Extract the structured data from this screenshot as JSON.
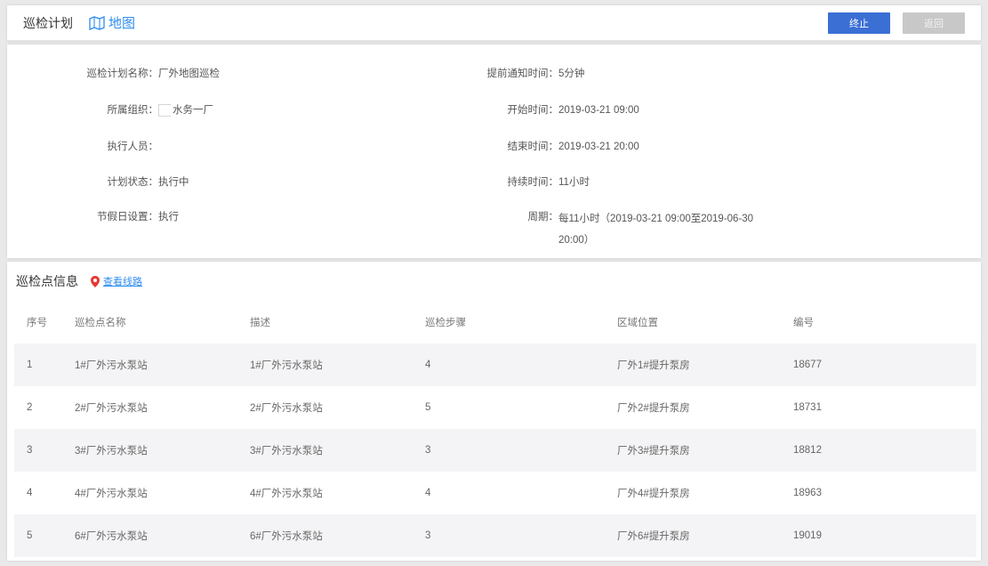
{
  "header": {
    "title": "巡检计划",
    "map_label": "地图",
    "stop_button": "终止",
    "return_button": "返回"
  },
  "info": {
    "left": [
      {
        "label": "巡检计划名称：",
        "value": "厂外地图巡检"
      },
      {
        "label": "所属组织：",
        "value": "水务一厂"
      },
      {
        "label": "执行人员：",
        "value": ""
      },
      {
        "label": "计划状态：",
        "value": "执行中"
      },
      {
        "label": "节假日设置：",
        "value": "执行"
      }
    ],
    "right": [
      {
        "label": "提前通知时间：",
        "value": "5分钟"
      },
      {
        "label": "开始时间：",
        "value": "2019-03-21 09:00"
      },
      {
        "label": "结束时间：",
        "value": "2019-03-21 20:00"
      },
      {
        "label": "持续时间：",
        "value": "11小时"
      },
      {
        "label": "周期：",
        "value": "每11小时（2019-03-21 09:00至2019-06-30 20:00）"
      }
    ]
  },
  "points": {
    "title": "巡检点信息",
    "route_link": "查看线路",
    "columns": [
      "序号",
      "巡检点名称",
      "描述",
      "巡检步骤",
      "区域位置",
      "编号"
    ],
    "rows": [
      [
        "1",
        "1#厂外污水泵站",
        "1#厂外污水泵站",
        "4",
        "厂外1#提升泵房",
        "18677"
      ],
      [
        "2",
        "2#厂外污水泵站",
        "2#厂外污水泵站",
        "5",
        "厂外2#提升泵房",
        "18731"
      ],
      [
        "3",
        "3#厂外污水泵站",
        "3#厂外污水泵站",
        "3",
        "厂外3#提升泵房",
        "18812"
      ],
      [
        "4",
        "4#厂外污水泵站",
        "4#厂外污水泵站",
        "4",
        "厂外4#提升泵房",
        "18963"
      ],
      [
        "5",
        "6#厂外污水泵站",
        "6#厂外污水泵站",
        "3",
        "厂外6#提升泵房",
        "19019"
      ]
    ]
  },
  "colors": {
    "primary": "#3b6fd4",
    "link": "#2d8cf0",
    "disabled": "#c8c8c8",
    "pin": "#e53935"
  }
}
